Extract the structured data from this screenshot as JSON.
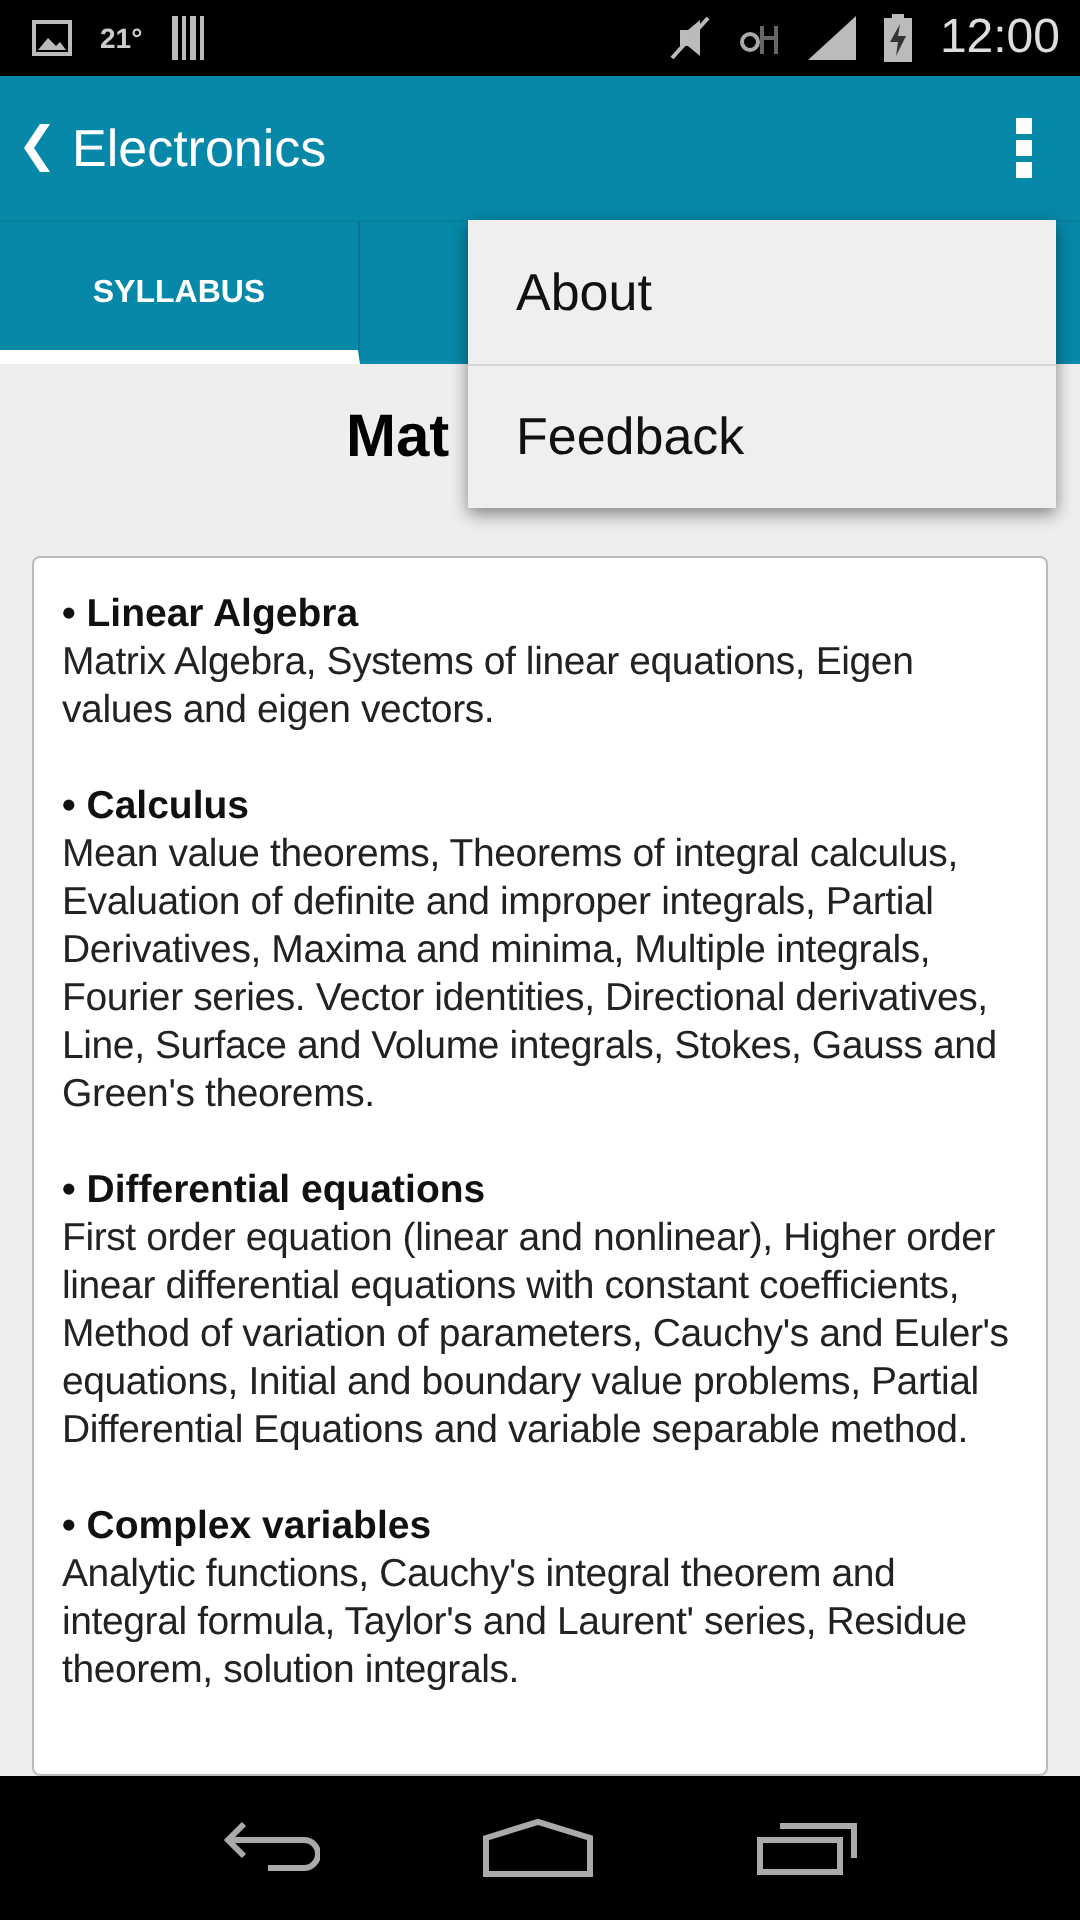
{
  "status_bar": {
    "temperature": "21°",
    "time": "12:00"
  },
  "app_bar": {
    "title": "Electronics"
  },
  "tabs": [
    {
      "label": "SYLLABUS",
      "selected": true
    }
  ],
  "heading": "Mat",
  "sections": [
    {
      "title": "• Linear Algebra",
      "body": "Matrix Algebra, Systems of linear equations, Eigen values and eigen vectors."
    },
    {
      "title": "• Calculus",
      "body": "Mean value theorems, Theorems of integral calculus, Evaluation of definite and improper integrals, Partial Derivatives, Maxima and minima, Multiple integrals, Fourier series. Vector identities, Directional derivatives, Line, Surface and Volume integrals, Stokes, Gauss and Green's theorems."
    },
    {
      "title": "• Differential equations",
      "body": "First order equation (linear and nonlinear), Higher order linear differential equations with constant coefficients, Method of variation of parameters, Cauchy's and Euler's equations, Initial and boundary value problems, Partial Differential Equations and variable separable method."
    },
    {
      "title": "• Complex variables",
      "body": "Analytic functions, Cauchy's integral theorem and integral formula, Taylor's and Laurent' series, Residue theorem, solution integrals."
    }
  ],
  "menu": {
    "items": [
      "About",
      "Feedback"
    ]
  }
}
